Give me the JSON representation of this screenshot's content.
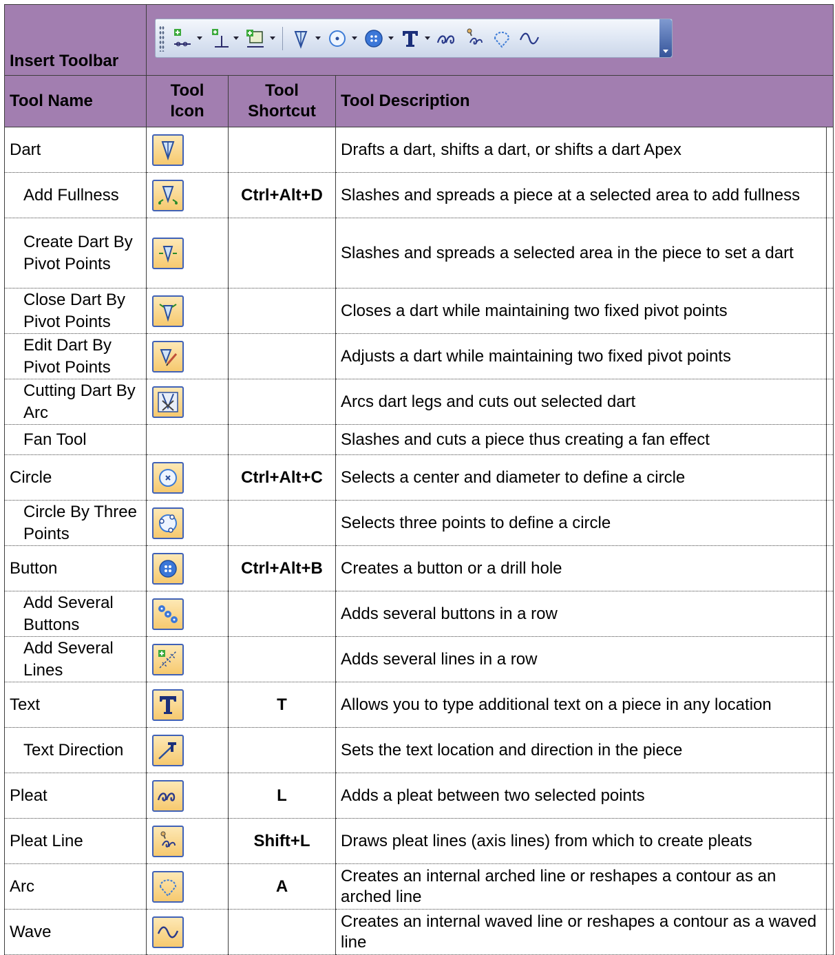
{
  "toolbar_title": "Insert Toolbar",
  "toolbar_icons": [
    "add-point-icon",
    "perpendicular-icon",
    "copy-piece-icon",
    "dart-icon",
    "circle-icon",
    "button-icon",
    "text-icon",
    "pleat-icon",
    "pleat-line-icon",
    "arc-icon",
    "wave-icon"
  ],
  "headers": {
    "name": "Tool Name",
    "icon_1": "Tool",
    "icon_2": "Icon",
    "shortcut_1": "Tool",
    "shortcut_2": "Shortcut",
    "desc": "Tool Description"
  },
  "rows": [
    {
      "name": "Dart",
      "icon": "dart-icon",
      "shortcut": "",
      "desc": "Drafts a dart, shifts a dart, or shifts a dart Apex"
    },
    {
      "name": "Add Fullness",
      "icon": "add-fullness-icon",
      "shortcut": "Ctrl+Alt+D",
      "desc": "Slashes and spreads a piece at a selected area to add fullness"
    },
    {
      "name": "Create Dart By Pivot Points",
      "icon": "create-dart-pivot-icon",
      "shortcut": "",
      "desc": "Slashes and spreads a selected area in the piece to set a dart"
    },
    {
      "name": "Close Dart By Pivot Points",
      "icon": "close-dart-pivot-icon",
      "shortcut": "",
      "desc": "Closes a dart while maintaining two fixed pivot points"
    },
    {
      "name": "Edit Dart By Pivot Points",
      "icon": "edit-dart-pivot-icon",
      "shortcut": "",
      "desc": "Adjusts a dart while maintaining two fixed pivot points"
    },
    {
      "name": "Cutting Dart By Arc",
      "icon": "cutting-dart-arc-icon",
      "shortcut": "",
      "desc": "Arcs dart legs and cuts out selected dart"
    },
    {
      "name": "Fan Tool",
      "icon": "",
      "shortcut": "",
      "desc": "Slashes and cuts a piece thus creating a fan effect"
    },
    {
      "name": "Circle",
      "icon": "circle-icon",
      "shortcut": "Ctrl+Alt+C",
      "desc": "Selects a center and diameter to define a circle"
    },
    {
      "name": "Circle By Three Points",
      "icon": "circle-three-points-icon",
      "shortcut": "",
      "desc": "Selects three points to define a circle"
    },
    {
      "name": "Button",
      "icon": "button-icon",
      "shortcut": "Ctrl+Alt+B",
      "desc": "Creates a button or a drill hole"
    },
    {
      "name": "Add Several Buttons",
      "icon": "add-several-buttons-icon",
      "shortcut": "",
      "desc": "Adds several buttons in a row"
    },
    {
      "name": "Add Several Lines",
      "icon": "add-several-lines-icon",
      "shortcut": "",
      "desc": "Adds several lines in a row"
    },
    {
      "name": "Text",
      "icon": "text-icon",
      "shortcut": "T",
      "desc": "Allows you to type additional text on a piece in any location"
    },
    {
      "name": "Text Direction",
      "icon": "text-direction-icon",
      "shortcut": "",
      "desc": "Sets the text location and direction in the piece"
    },
    {
      "name": "Pleat",
      "icon": "pleat-icon",
      "shortcut": "L",
      "desc": "Adds a pleat between two selected points"
    },
    {
      "name": "Pleat Line",
      "icon": "pleat-line-icon",
      "shortcut": "Shift+L",
      "desc": "Draws pleat lines (axis lines) from which to create pleats"
    },
    {
      "name": "Arc",
      "icon": "arc-icon",
      "shortcut": "A",
      "desc": "Creates an internal arched line or reshapes a contour as an arched line"
    },
    {
      "name": "Wave",
      "icon": "wave-icon",
      "shortcut": "",
      "desc": "Creates an internal waved line or reshapes a contour as a waved line"
    }
  ]
}
